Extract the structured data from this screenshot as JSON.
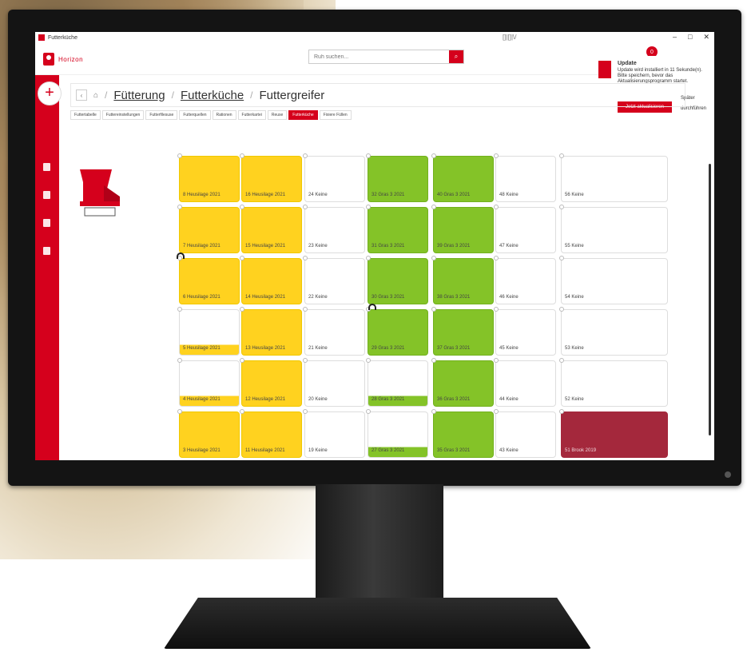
{
  "window": {
    "title": "Futterküche",
    "center_indicator": "[]|[]|\\/"
  },
  "header": {
    "brand": "Horizon",
    "search_placeholder": "Ruh suchen...",
    "notification_count": "0"
  },
  "notification": {
    "title": "Update",
    "body": "Update wird installiert in 11 Sekunde(n). Bitte speichern, bevor das Aktualisierungsprogramm startet.",
    "primary": "Jetzt aktualisieren",
    "later": "Später",
    "run": "durchführen"
  },
  "breadcrumb": {
    "level1": "Fütterung",
    "level2": "Futterküche",
    "level3": "Futtergreifer"
  },
  "tabs": [
    "Futtertabelle",
    "Futtereinstellungen",
    "Futterfilesuse",
    "Futterquellen",
    "Rationen",
    "Futterkartei",
    "Reuse",
    "Futterküche",
    "Fixiere Füllen"
  ],
  "active_tab": "Futterküche",
  "bunkers": {
    "col1": [
      "8 Heusilage 2021",
      "7 Heusilage 2021",
      "6 Heusilage 2021",
      "5 Heusilage 2021",
      "4 Heusilage 2021",
      "3 Heusilage 2021"
    ],
    "col2": [
      "16 Heusilage 2021",
      "15 Heusilage 2021",
      "14 Heusilage 2021",
      "13 Heusilage 2021",
      "12 Heusilage 2021",
      "11 Heusilage 2021"
    ],
    "col3": [
      "24 Keine",
      "23 Keine",
      "22 Keine",
      "21 Keine",
      "20 Keine",
      "19 Keine"
    ],
    "col4": [
      "32 Gras 3 2021",
      "31 Gras 3 2021",
      "30 Gras 3 2021",
      "29 Gras 3 2021",
      "28 Gras 3 2021",
      "27 Gras 3 2021"
    ],
    "col5": [
      "40 Gras 3 2021",
      "39 Gras 3 2021",
      "38 Gras 3 2021",
      "37 Gras 3 2021",
      "36 Gras 3 2021",
      "35 Gras 3 2021"
    ],
    "col6": [
      "48 Keine",
      "47 Keine",
      "46 Keine",
      "45 Keine",
      "44 Keine",
      "43 Keine"
    ],
    "col7": [
      "56 Keine",
      "55 Keine",
      "54 Keine",
      "53 Keine",
      "52 Keine",
      "51 Brook 2019"
    ]
  },
  "colors": {
    "brand_red": "#d5001c",
    "heusilage": "#ffd21f",
    "gras": "#84c328",
    "brook": "#a4283c"
  }
}
